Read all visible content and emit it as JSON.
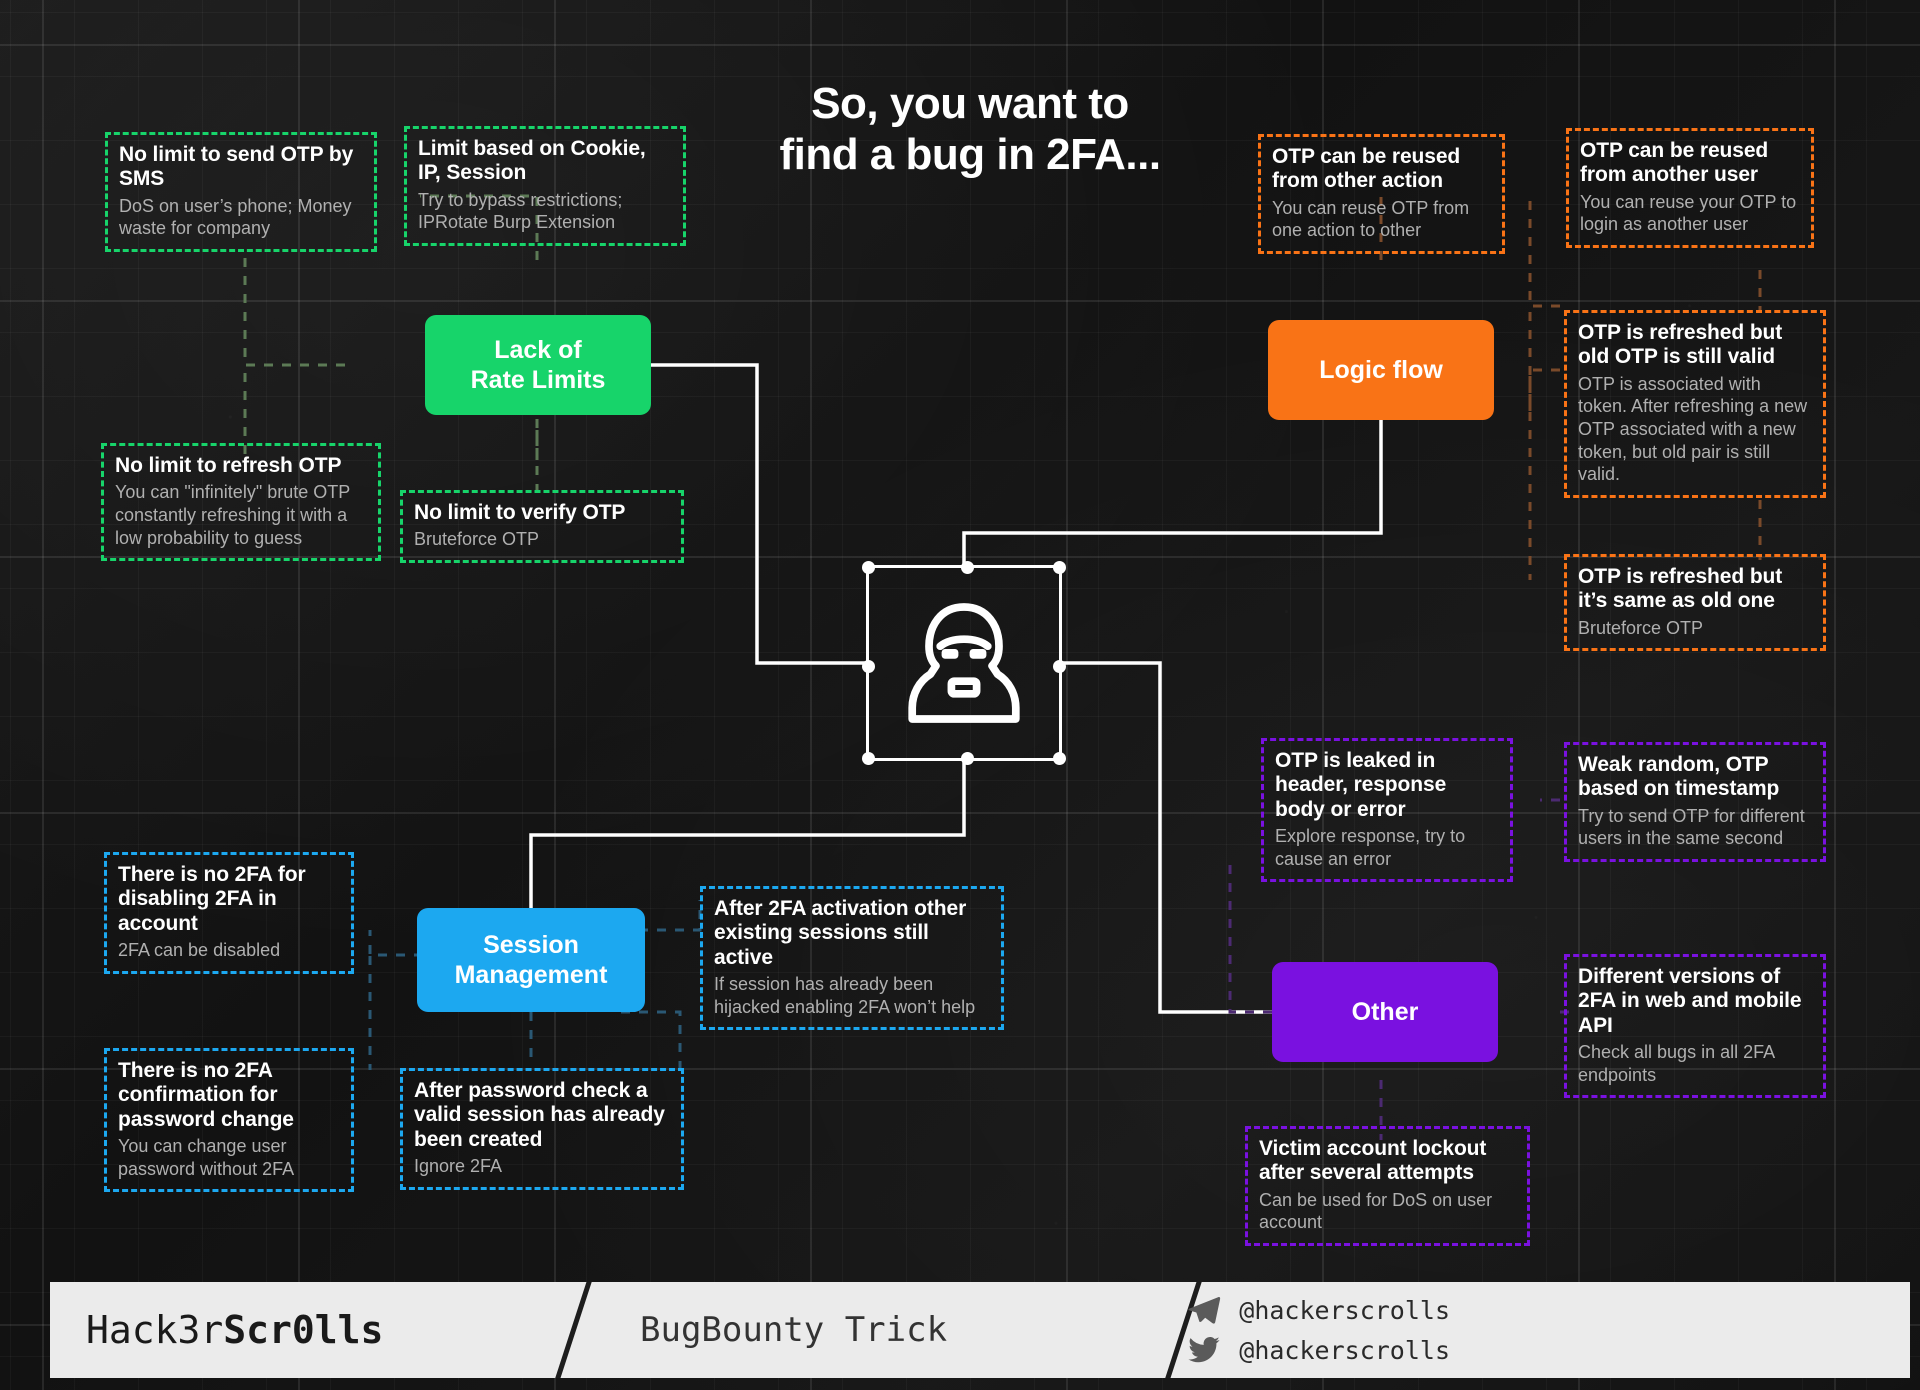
{
  "title": {
    "line1": "So, you want to",
    "line2": "find a bug in 2FA..."
  },
  "colors": {
    "green": "#17d46a",
    "orange": "#f97316",
    "blue": "#1ca8f0",
    "purple": "#7a11e0",
    "background": "#161616",
    "wire": "#ffffff",
    "note_title": "#ffffff",
    "note_desc": "#b0b0b0"
  },
  "hub": {
    "icon": "hacker-hoodie-icon"
  },
  "categories": [
    {
      "id": "lack-of-rate-limits",
      "label": "Lack of\nRate Limits",
      "color": "#17d46a"
    },
    {
      "id": "logic-flow",
      "label": "Logic flow",
      "color": "#f97316"
    },
    {
      "id": "session-management",
      "label": "Session\nManagement",
      "color": "#1ca8f0"
    },
    {
      "id": "other",
      "label": "Other",
      "color": "#7a11e0"
    }
  ],
  "notes": [
    {
      "id": "no-limit-send-otp-sms",
      "category": "lack-of-rate-limits",
      "color": "#17d46a",
      "title": "No limit to send OTP by SMS",
      "desc": "DoS on user’s phone; Money waste for company"
    },
    {
      "id": "limit-based-on-cookie-ip-session",
      "category": "lack-of-rate-limits",
      "color": "#17d46a",
      "title": "Limit based on Cookie, IP, Session",
      "desc": "Try to bypass restrictions; IPRotate Burp Extension"
    },
    {
      "id": "no-limit-refresh-otp",
      "category": "lack-of-rate-limits",
      "color": "#17d46a",
      "title": "No limit to refresh OTP",
      "desc": "You can \"infinitely\" brute OTP constantly refreshing it with a low probability to guess"
    },
    {
      "id": "no-limit-verify-otp",
      "category": "lack-of-rate-limits",
      "color": "#17d46a",
      "title": "No limit to verify OTP",
      "desc": "Bruteforce OTP"
    },
    {
      "id": "otp-reused-other-action",
      "category": "logic-flow",
      "color": "#f97316",
      "title": "OTP can be reused from other action",
      "desc": "You can reuse OTP from one action to other"
    },
    {
      "id": "otp-reused-another-user",
      "category": "logic-flow",
      "color": "#f97316",
      "title": "OTP can be reused from another user",
      "desc": "You can reuse your OTP to login as another user"
    },
    {
      "id": "otp-refreshed-old-still-valid",
      "category": "logic-flow",
      "color": "#f97316",
      "title": "OTP is refreshed but old OTP is still valid",
      "desc": "OTP is associated with token. After refreshing a new OTP associated with a new token, but old pair is still valid."
    },
    {
      "id": "otp-refreshed-same-as-old",
      "category": "logic-flow",
      "color": "#f97316",
      "title": "OTP is refreshed but it’s same as old one",
      "desc": "Bruteforce OTP"
    },
    {
      "id": "no-2fa-for-disabling-2fa",
      "category": "session-management",
      "color": "#1ca8f0",
      "title": "There is no 2FA for disabling 2FA in account",
      "desc": "2FA can be disabled"
    },
    {
      "id": "no-2fa-confirmation-password-change",
      "category": "session-management",
      "color": "#1ca8f0",
      "title": "There is no 2FA confirmation for password change",
      "desc": "You can change user password without 2FA"
    },
    {
      "id": "after-2fa-activation-sessions-active",
      "category": "session-management",
      "color": "#1ca8f0",
      "title": "After 2FA activation other existing sessions still active",
      "desc": "If session has already been hijacked enabling 2FA won’t help"
    },
    {
      "id": "after-password-check-session-created",
      "category": "session-management",
      "color": "#1ca8f0",
      "title": "After password check a valid session has already been created",
      "desc": "Ignore 2FA"
    },
    {
      "id": "otp-leaked-in-header-response",
      "category": "other",
      "color": "#7a11e0",
      "title": "OTP is leaked in header, response body or error",
      "desc": "Explore response, try to cause an error"
    },
    {
      "id": "weak-random-otp-timestamp",
      "category": "other",
      "color": "#7a11e0",
      "title": "Weak random, OTP based on timestamp",
      "desc": "Try to send OTP for different users in the same second"
    },
    {
      "id": "different-versions-2fa-web-mobile",
      "category": "other",
      "color": "#7a11e0",
      "title": "Different versions of 2FA in web and mobile API",
      "desc": "Check all bugs in all 2FA endpoints"
    },
    {
      "id": "victim-account-lockout",
      "category": "other",
      "color": "#7a11e0",
      "title": "Victim account lockout after several attempts",
      "desc": "Can be used for DoS on user account"
    }
  ],
  "footer": {
    "brand_prefix": "Hack3r",
    "brand_suffix": "Scr0lls",
    "tagline": "BugBounty Trick",
    "socials": [
      {
        "icon": "telegram-icon",
        "handle": "@hackerscrolls"
      },
      {
        "icon": "twitter-icon",
        "handle": "@hackerscrolls"
      }
    ]
  }
}
